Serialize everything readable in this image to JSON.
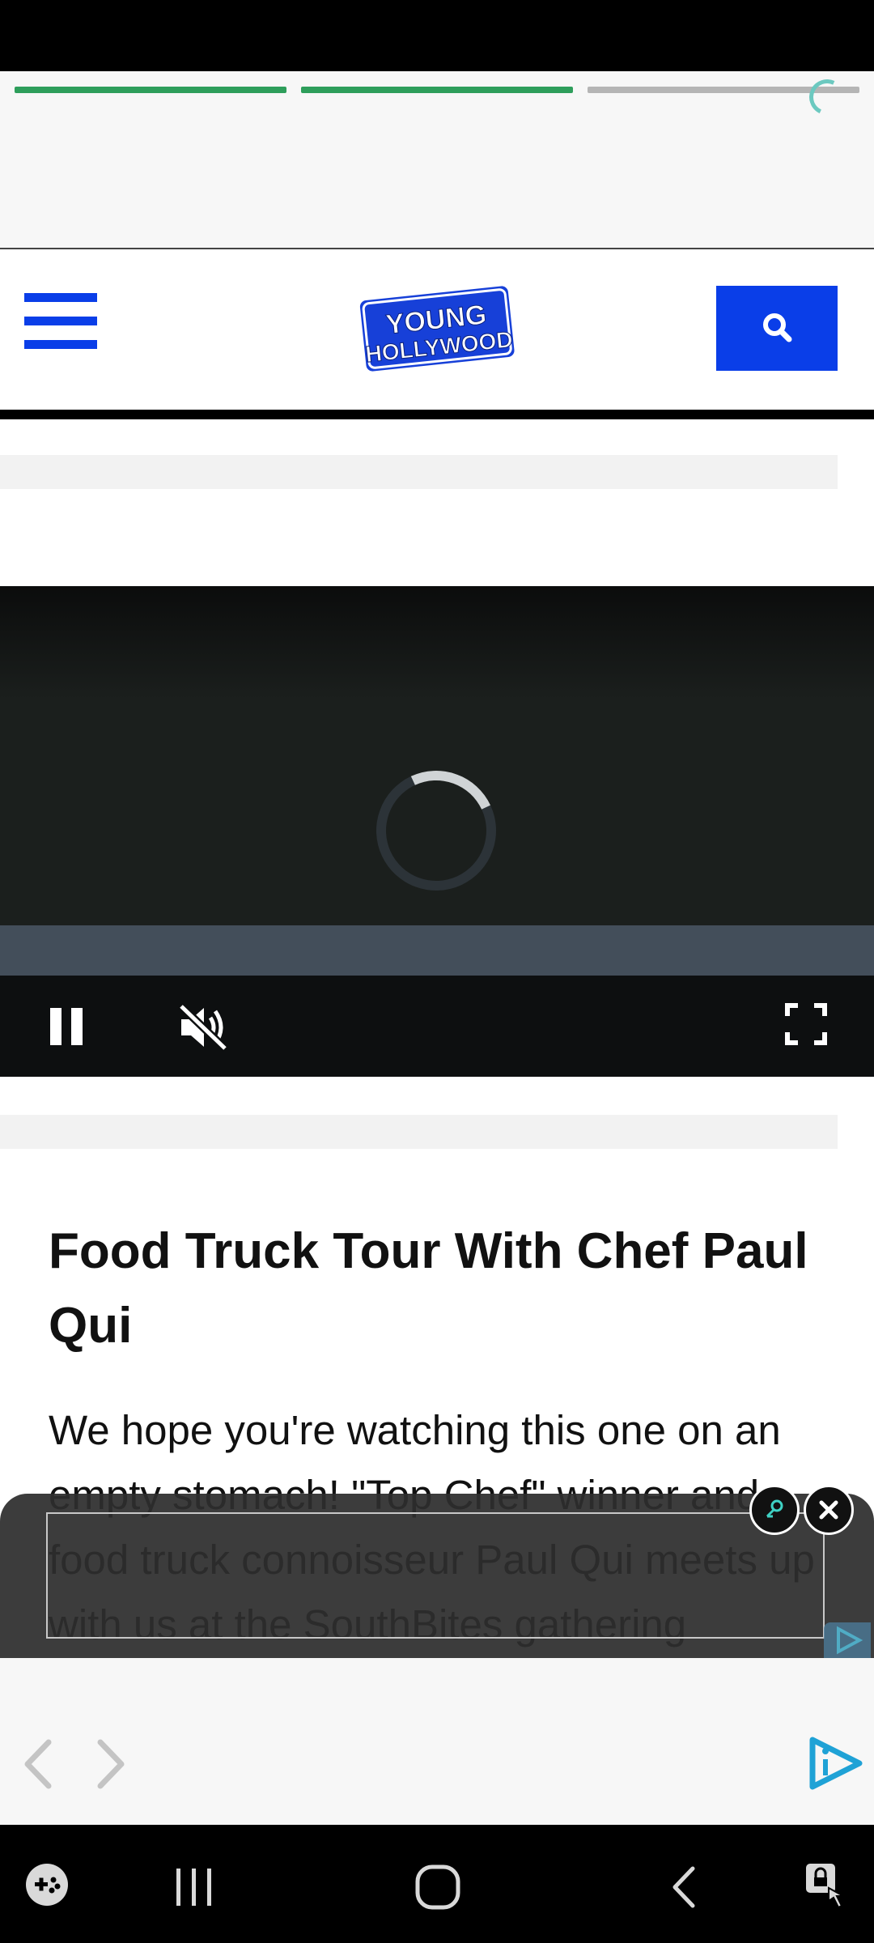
{
  "story": {
    "segments": [
      {
        "state": "complete",
        "color": "#2e9e5b"
      },
      {
        "state": "complete",
        "color": "#2e9e5b"
      },
      {
        "state": "pending",
        "color": "#b5b5b5"
      }
    ],
    "loading_icon": "spinner-icon"
  },
  "header": {
    "menu_icon": "hamburger-menu-icon",
    "logo_line1": "YOUNG",
    "logo_line2": "HOLLYWOOD",
    "search_icon": "search-icon",
    "accent_color": "#0a3ee8"
  },
  "video": {
    "state": "loading",
    "controls": {
      "pause_icon": "pause-icon",
      "mute_icon": "muted-speaker-icon",
      "fullscreen_icon": "fullscreen-icon"
    }
  },
  "article": {
    "title": "Food Truck Tour With Chef Paul Qui",
    "body": "We hope you're watching this one on an empty stomach! \"Top Chef\" winner and food truck connoisseur Paul Qui meets up with us at the SouthBites gathering"
  },
  "ad": {
    "info_icon": "ad-info-icon",
    "close_icon": "close-icon",
    "corner_icon": "ad-choices-icon"
  },
  "browser_bar": {
    "back_icon": "chevron-left-icon",
    "forward_icon": "chevron-right-icon",
    "brand_icon": "play-info-icon"
  },
  "android_nav": {
    "game_icon": "game-launcher-icon",
    "recents_icon": "recent-apps-icon",
    "home_icon": "home-icon",
    "back_icon": "back-icon",
    "accessibility_icon": "accessibility-icon"
  }
}
